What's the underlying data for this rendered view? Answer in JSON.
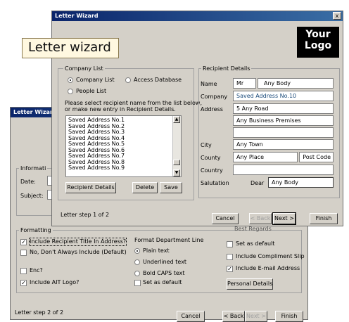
{
  "back_window": {
    "title": "Letter Wizard",
    "info_group_label": "Informati",
    "date_label": "Date:",
    "subject_label": "Subject:",
    "formatting_label": "Formatting",
    "cb_recipient_title": "Include Recipient Title In Address?",
    "cb_no_dont": "No, Don't Always Include (Default)",
    "cb_enc": "Enc?",
    "cb_ait_logo": "Include AIT Logo?",
    "format_dept_label": "Format Department Line",
    "radio_plain": "Plain text",
    "radio_underlined": "Underlined text",
    "radio_bold_caps": "Bold CAPS text",
    "cb_set_default_dept": "Set as default",
    "best_regards": "Best Regards",
    "cb_set_default": "Set as default",
    "cb_compliment": "Include Compliment Slip",
    "cb_email": "Include E-mail Address",
    "personal_details_button": "Personal Details",
    "step_text": "Letter step  2 of 2",
    "cancel_button": "Cancel",
    "back_button": "< Back",
    "next_button": "Next >",
    "finish_button": "Finish"
  },
  "front_window": {
    "title": "Letter Wizard",
    "close_glyph": "x",
    "logo_line1": "Your",
    "logo_line2": "Logo",
    "company_list_group": "Company List",
    "radio_company_list": "Company List",
    "radio_access_db": "Access Database",
    "radio_people_list": "People List",
    "instruction_line1": "Please select recipient name from the list below,",
    "instruction_line2": "or make new entry in Recipient Details.",
    "saved_addresses": [
      "Saved Address No.1",
      "Saved Address No.2",
      "Saved Address No.3",
      "Saved Address No.4",
      "Saved Address No.5",
      "Saved Address No.6",
      "Saved Address No.7",
      "Saved Address No.8",
      "Saved Address No.9"
    ],
    "recipient_details_button": "Recipient Details",
    "delete_button": "Delete",
    "save_button": "Save",
    "recipient_group": "Recipient Details",
    "name_label": "Name",
    "title_value": "Mr",
    "name_value": "Any Body",
    "company_label": "Company",
    "company_value": "Saved Address No.10",
    "address_label": "Address",
    "address_line1": "5 Any Road",
    "address_line2": "Any Business Premises",
    "address_line3": "",
    "city_label": "City",
    "city_value": "Any Town",
    "county_label": "County",
    "county_value": "Any Place",
    "postcode_label": "Post Code",
    "country_label": "Country",
    "country_value": "",
    "salutation_label": "Salutation",
    "salutation_prefix": "Dear",
    "salutation_value": "Any Body",
    "step_text": "Letter step  1 of 2",
    "cancel_button": "Cancel",
    "back_button": "< Back",
    "next_button": "Next >",
    "finish_button": "Finish"
  },
  "callout_text": "Letter wizard",
  "colors": {
    "title_gradient_start": "#0a246a",
    "title_gradient_end": "#3a6ea5",
    "dialog_face": "#d4d0c8",
    "company_value_color": "#1a4a7a"
  }
}
